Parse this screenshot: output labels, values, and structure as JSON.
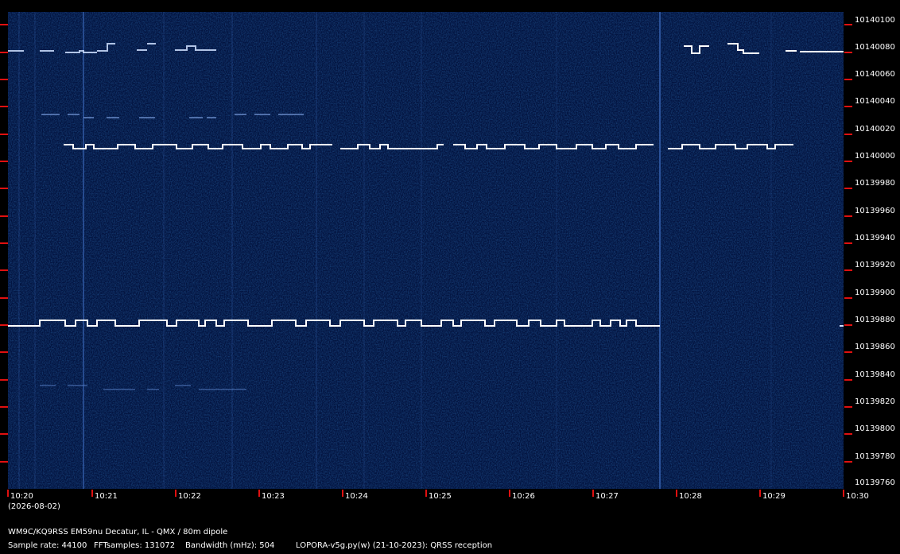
{
  "freq_axis": {
    "labels": [
      "10140100",
      "10140080",
      "10140060",
      "10140040",
      "10140020",
      "10140000",
      "10139980",
      "10139960",
      "10139940",
      "10139920",
      "10139900",
      "10139880",
      "10139860",
      "10139840",
      "10139820",
      "10139800",
      "10139780",
      "10139760"
    ]
  },
  "time_axis": {
    "labels": [
      "10:20",
      "10:21",
      "10:22",
      "10:23",
      "10:24",
      "10:25",
      "10:26",
      "10:27",
      "10:28",
      "10:29",
      "10:30"
    ],
    "date": "(2026-08-02)"
  },
  "footer": {
    "station": "WM9C/KQ9RSS EM59nu Decatur, IL - QMX / 80m dipole",
    "sample_rate": "Sample rate: 44100",
    "fft_samples": "FFTsamples: 131072",
    "bandwidth": "Bandwidth (mHz): 504",
    "software": "LOPORA-v5g.py(w) (21-10-2023): QRSS reception"
  },
  "colors": {
    "background": "#03133f",
    "tick": "#e01010",
    "signal": "#ffffff"
  }
}
